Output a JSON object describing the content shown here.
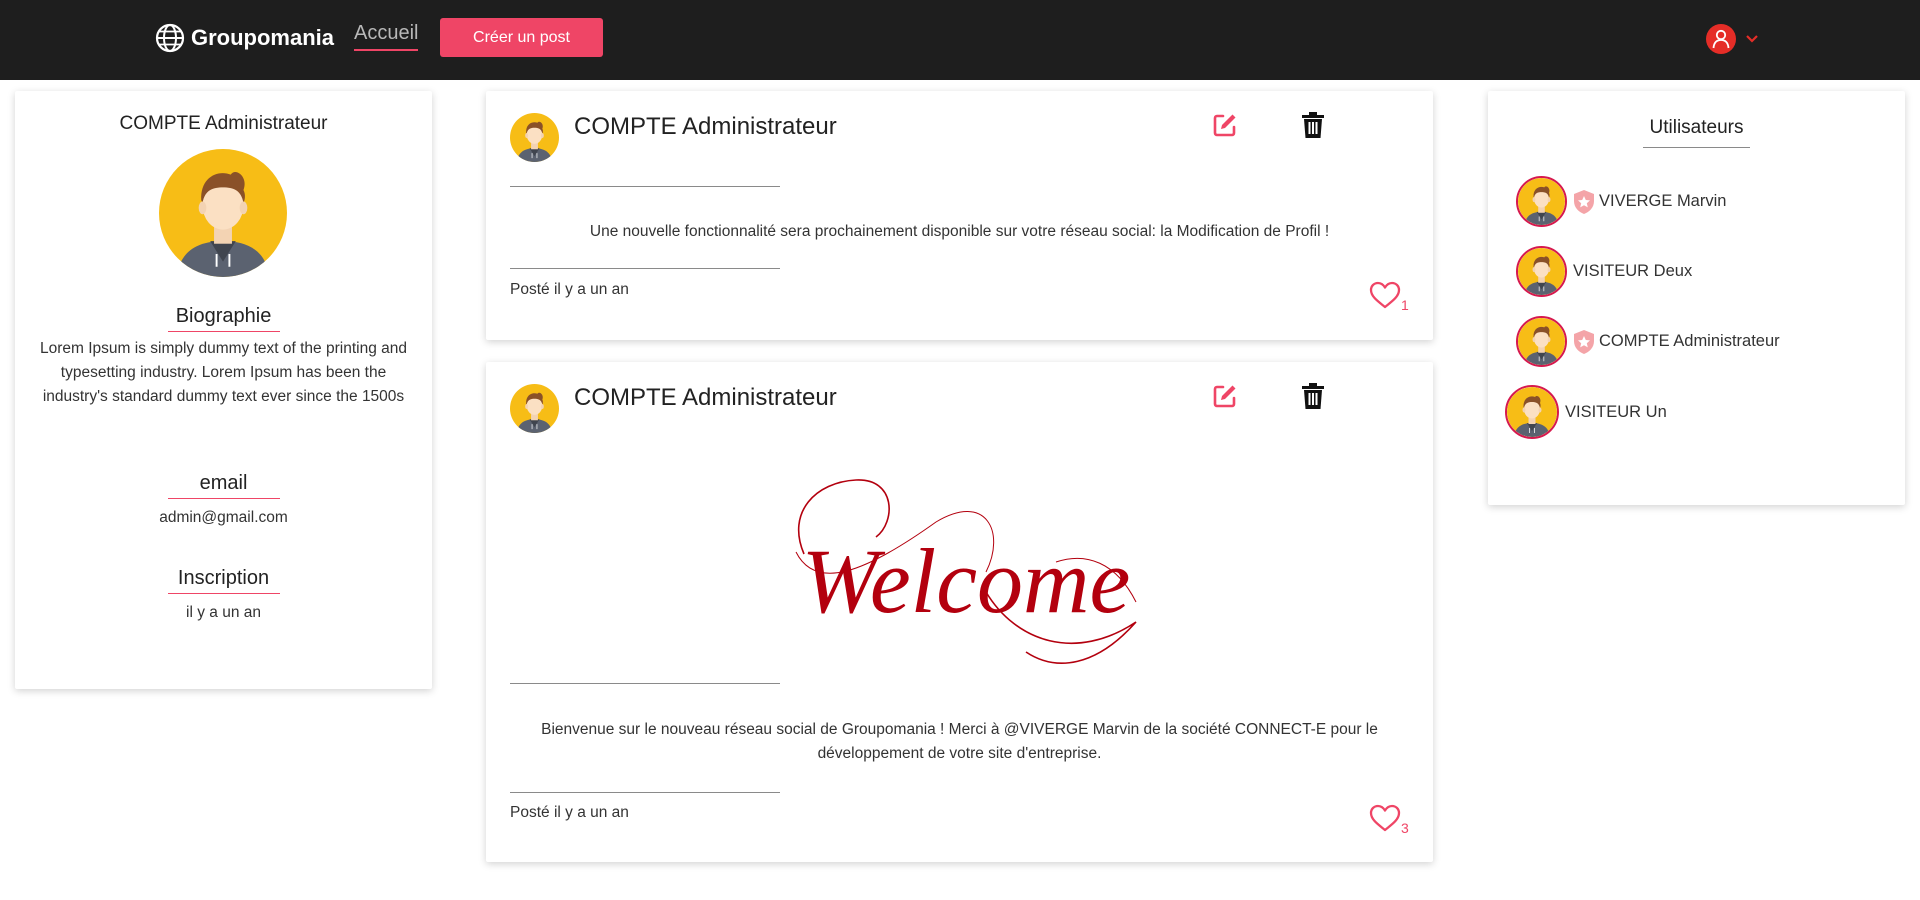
{
  "navbar": {
    "brand": "Groupomania",
    "nav_link": "Accueil",
    "create_button": "Créer un post",
    "icons": {
      "brand": "globe-icon",
      "user": "user-circle-icon",
      "menu": "chevron-down-icon"
    }
  },
  "profile": {
    "name": "COMPTE Administrateur",
    "bio_title": "Biographie",
    "bio_text": "Lorem Ipsum is simply dummy text of the printing and typesetting industry. Lorem Ipsum has been the industry's standard dummy text ever since the 1500s",
    "email_title": "email",
    "email": "admin@gmail.com",
    "signup_title": "Inscription",
    "signup_date": "il y a un an"
  },
  "posts": [
    {
      "author": "COMPTE Administrateur",
      "text": "Une nouvelle fonctionnalité sera prochainement disponible sur votre réseau social: la Modification de Profil !",
      "date": "Posté il y a un an",
      "likes": "1"
    },
    {
      "author": "COMPTE Administrateur",
      "image_text": "Welcome",
      "text": "Bienvenue sur le nouveau réseau social de Groupomania ! Merci à @VIVERGE Marvin de la société CONNECT-E pour le développement de votre site d'entreprise.",
      "date": "Posté il y a un an",
      "likes": "3"
    }
  ],
  "users_panel": {
    "title": "Utilisateurs",
    "users": [
      {
        "name": "VIVERGE Marvin",
        "admin": true
      },
      {
        "name": "VISITEUR Deux",
        "admin": false
      },
      {
        "name": "COMPTE Administrateur",
        "admin": true
      },
      {
        "name": "VISITEUR Un",
        "admin": false
      }
    ]
  },
  "colors": {
    "navbar": "#1e1e1e",
    "accent": "#ef4566",
    "avatar_bg": "#f7bd16",
    "welcome_red": "#b3000e"
  }
}
